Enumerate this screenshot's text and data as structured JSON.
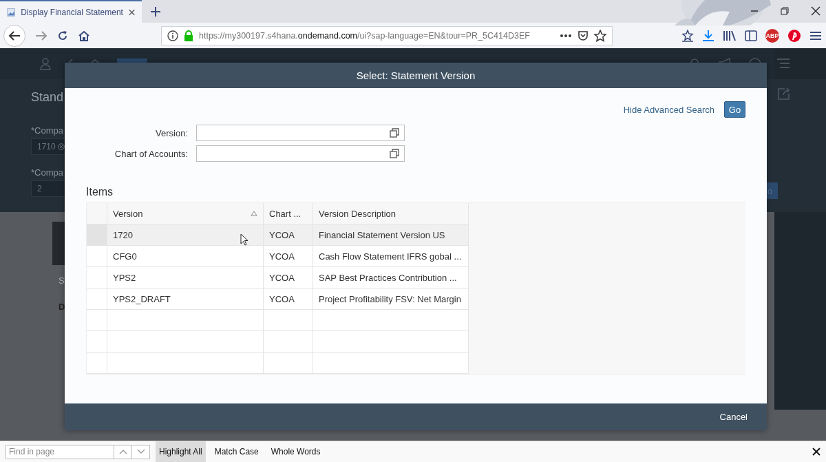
{
  "browser": {
    "tab": {
      "title": "Display Financial Statement",
      "selected": true
    },
    "url": "https://my300197.s4hana.**ondemand.com**/ui?sap-language=EN&tour=PR_5C414D3EF",
    "extension_badge": "ABP"
  },
  "app": {
    "page_title": "Stand",
    "filters": [
      {
        "label": "*Compa",
        "value": "1710",
        "token": true
      },
      {
        "label": "*Compa",
        "value": "2",
        "token": false
      }
    ],
    "go_button": "o",
    "tab_letter": "S",
    "row_letter": "D"
  },
  "dialog": {
    "title": "Select: Statement Version",
    "advanced_search_link": "Hide Advanced Search",
    "go_button": "Go",
    "fields": [
      {
        "label": "Version:"
      },
      {
        "label": "Chart of Accounts:"
      }
    ],
    "items_title": "Items",
    "table": {
      "columns": [
        {
          "label": "Version",
          "sorted": true
        },
        {
          "label": "Chart ...",
          "sorted": false
        },
        {
          "label": "Version Description",
          "sorted": false
        }
      ],
      "rows": [
        {
          "cells": [
            "1720",
            "YCOA",
            "Financial Statement Version US"
          ],
          "selected": true
        },
        {
          "cells": [
            "CFG0",
            "YCOA",
            "Cash Flow Statement IFRS gobal ..."
          ],
          "selected": false
        },
        {
          "cells": [
            "YPS2",
            "YCOA",
            "SAP Best Practices Contribution ..."
          ],
          "selected": false
        },
        {
          "cells": [
            "YPS2_DRAFT",
            "YCOA",
            "Project Profitability FSV: Net Margin"
          ],
          "selected": false
        }
      ]
    },
    "cancel_button": "Cancel"
  },
  "find_bar": {
    "placeholder": "Find in page",
    "options": [
      {
        "label": "Highlight All",
        "selected": true
      },
      {
        "label": "Match Case",
        "selected": false
      },
      {
        "label": "Whole Words",
        "selected": false
      }
    ]
  }
}
